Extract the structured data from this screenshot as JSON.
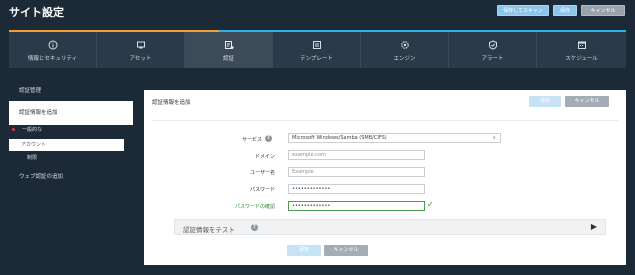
{
  "header": {
    "title": "サイト設定",
    "buttons": [
      "保存してスキャン",
      "保存",
      "キャンセル"
    ]
  },
  "tabs": [
    {
      "label": "情報とセキュリティ",
      "icon": "info-icon",
      "active": false
    },
    {
      "label": "アセット",
      "icon": "assets-icon",
      "active": false
    },
    {
      "label": "認証",
      "icon": "auth-icon",
      "active": true
    },
    {
      "label": "テンプレート",
      "icon": "template-icon",
      "active": false
    },
    {
      "label": "エンジン",
      "icon": "engine-icon",
      "active": false
    },
    {
      "label": "アラート",
      "icon": "alert-icon",
      "active": false
    },
    {
      "label": "スケジュール",
      "icon": "schedule-icon",
      "active": false
    }
  ],
  "sidebar": {
    "heading": "認証管理",
    "active_item": "認証情報を追加",
    "sub_items": [
      "一般的な",
      "アカウント",
      "制限"
    ],
    "link": "ウェブ認証の追加"
  },
  "panel": {
    "title": "認証情報を追加",
    "save_label": "保存",
    "cancel_label": "キャンセル",
    "fields": {
      "service_label": "サービス",
      "service_value": "Microsoft Windows/Samba (SMB/CIFS)",
      "domain_label": "ドメイン",
      "domain_placeholder": "example.com",
      "user_label": "ユーザー名",
      "user_placeholder": "Example",
      "password_label": "パスワード",
      "password_value": "•••••••••••••",
      "confirm_label": "パスワードの確認",
      "confirm_value": "•••••••••••••"
    },
    "test_label": "認証情報をテスト"
  },
  "colors": {
    "background": "#1c2a38",
    "accent_orange": "#f0a030",
    "accent_blue": "#28b4e6",
    "primary_button": "#8ec6ea",
    "valid_green": "#3a9a3a"
  }
}
